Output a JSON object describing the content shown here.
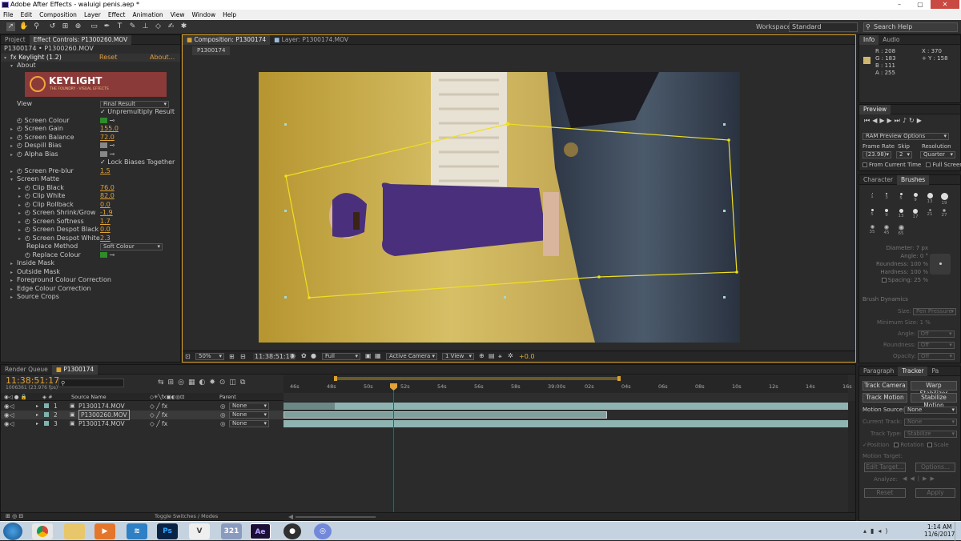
{
  "window": {
    "title": "Adobe After Effects - waluigi penis.aep *",
    "min": "–",
    "max": "▢",
    "close": "✕"
  },
  "menu": [
    "File",
    "Edit",
    "Composition",
    "Layer",
    "Effect",
    "Animation",
    "View",
    "Window",
    "Help"
  ],
  "toolbar": {
    "workspace_label": "Workspace:",
    "workspace_value": "Standard",
    "search_placeholder": "Search Help"
  },
  "left": {
    "tab_project": "Project",
    "tab_effect": "Effect Controls: P1300260.MOV",
    "breadcrumb": "P1300174 • P1300260.MOV",
    "effect_name": "Keylight (1.2)",
    "reset": "Reset",
    "about": "About...",
    "about_label": "About",
    "logo": "KEYLIGHT",
    "logo_sub": "THE FOUNDRY · VISUAL EFFECTS",
    "view_label": "View",
    "view_value": "Final Result",
    "unpremultiply": "Unpremultiply Result",
    "screen_colour": "Screen Colour",
    "screen_gain": "Screen Gain",
    "screen_gain_v": "155.0",
    "screen_balance": "Screen Balance",
    "screen_balance_v": "72.0",
    "despill_bias": "Despill Bias",
    "alpha_bias": "Alpha Bias",
    "lock_biases": "Lock Biases Together",
    "screen_preblur": "Screen Pre-blur",
    "screen_preblur_v": "1.5",
    "screen_matte": "Screen Matte",
    "clip_black": "Clip Black",
    "clip_black_v": "76.0",
    "clip_white": "Clip White",
    "clip_white_v": "82.0",
    "clip_rollback": "Clip Rollback",
    "clip_rollback_v": "0.0",
    "shrink": "Screen Shrink/Grow",
    "shrink_v": "-1.9",
    "softness": "Screen Softness",
    "softness_v": "1.7",
    "despot_black": "Screen Despot Black",
    "despot_black_v": "0.0",
    "despot_white": "Screen Despot White",
    "despot_white_v": "2.3",
    "replace_method": "Replace Method",
    "replace_method_v": "Soft Colour",
    "replace_colour": "Replace Colour",
    "inside_mask": "Inside Mask",
    "outside_mask": "Outside Mask",
    "fg_correction": "Foreground Colour Correction",
    "edge_correction": "Edge Colour Correction",
    "source_crops": "Source Crops"
  },
  "comp": {
    "tab_comp": "Composition: P1300174",
    "tab_layer": "Layer: P1300174.MOV",
    "subtab": "P1300174",
    "zoom": "50%",
    "timecode": "11:38:51:17",
    "resolution": "Full",
    "camera": "Active Camera",
    "views": "1 View",
    "exposure": "+0.0"
  },
  "info": {
    "tab_info": "Info",
    "tab_audio": "Audio",
    "r": "R : 208",
    "g": "G : 183",
    "b": "B : 111",
    "a": "A : 255",
    "x": "X : 370",
    "y": "+ Y : 158"
  },
  "preview": {
    "tab": "Preview",
    "ram": "RAM Preview Options",
    "fr_label": "Frame Rate",
    "skip_label": "Skip",
    "res_label": "Resolution",
    "fr_value": "(23.98)",
    "skip_value": "2",
    "res_value": "Quarter",
    "from_current": "From Current Time",
    "full_screen": "Full Screen"
  },
  "brushes": {
    "tab_char": "Character",
    "tab_brushes": "Brushes",
    "sizes": [
      "1",
      "3",
      "5",
      "9",
      "13",
      "19",
      "5",
      "9",
      "13",
      "17",
      "21",
      "27",
      "35",
      "45",
      "65"
    ],
    "diameter": "Diameter: 7 px",
    "angle": "Angle: 0 °",
    "roundness": "Roundness: 100 %",
    "hardness": "Hardness: 100 %",
    "spacing": "Spacing: 25 %",
    "dynamics": "Brush Dynamics",
    "size": "Size:",
    "size_v": "Pen Pressure",
    "min_size": "Minimum Size: 1 %",
    "angle2": "Angle:",
    "roundness2": "Roundness:",
    "opacity": "Opacity:",
    "off": "Off"
  },
  "tracker": {
    "tab_para": "Paragraph",
    "tab_tracker": "Tracker",
    "tab_pa": "Pa",
    "track_camera": "Track Camera",
    "warp": "Warp Stabilizer",
    "track_motion": "Track Motion",
    "stabilize": "Stabilize Motion",
    "motion_source": "Motion Source:",
    "none": "None",
    "current_track": "Current Track:",
    "track_type": "Track Type:",
    "track_type_v": "Stabilize",
    "position": "Position",
    "rotation": "Rotation",
    "scale": "Scale",
    "motion_target": "Motion Target:",
    "edit_target": "Edit Target...",
    "options": "Options...",
    "analyze": "Analyze:",
    "reset": "Reset",
    "apply": "Apply"
  },
  "timeline": {
    "tab_render": "Render Queue",
    "tab_comp": "P1300174",
    "timecode": "11:38:51:17",
    "fps": "1006361 (23.976 fps)",
    "search_icon": "search",
    "col_source": "Source Name",
    "col_parent": "Parent",
    "layers": [
      {
        "num": "1",
        "name": "P1300174.MOV",
        "parent": "None"
      },
      {
        "num": "2",
        "name": "P1300260.MOV",
        "parent": "None"
      },
      {
        "num": "3",
        "name": "P1300174.MOV",
        "parent": "None"
      }
    ],
    "ruler": [
      "46s",
      "48s",
      "50s",
      "52s",
      "54s",
      "56s",
      "58s",
      "39:00s",
      "02s",
      "04s",
      "06s",
      "08s",
      "10s",
      "12s",
      "14s",
      "16s"
    ],
    "toggle": "Toggle Switches / Modes"
  },
  "taskbar": {
    "time": "1:14 AM",
    "date": "11/6/2017",
    "apps": [
      "start",
      "chrome",
      "explorer",
      "media",
      "edge",
      "photoshop",
      "vegas",
      "calendar",
      "after-effects",
      "obs",
      "discord"
    ]
  },
  "colors": {
    "accent": "#e29b3a",
    "motion_path": "#f0e020",
    "playhead": "#d02020",
    "layer_bar": "#8fb3b0"
  }
}
